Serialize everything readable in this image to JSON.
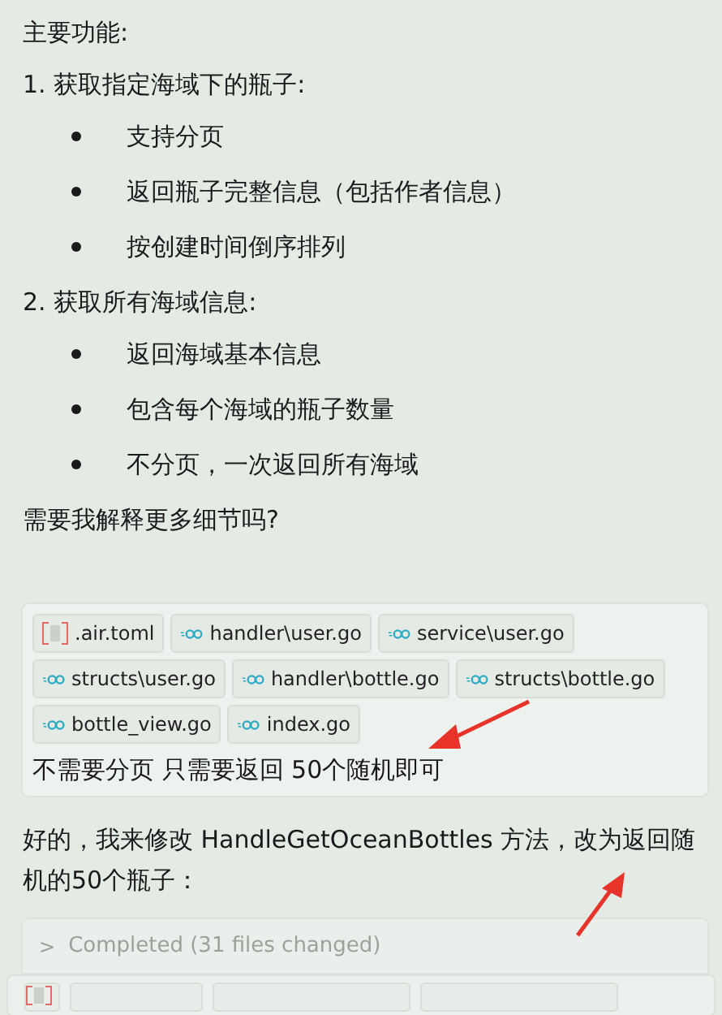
{
  "intro": "主要功能:",
  "sections": [
    {
      "title": "1. 获取指定海域下的瓶子:",
      "bullets": [
        "支持分页",
        "返回瓶子完整信息（包括作者信息）",
        "按创建时间倒序排列"
      ]
    },
    {
      "title": "2. 获取所有海域信息:",
      "bullets": [
        "返回海域基本信息",
        "包含每个海域的瓶子数量",
        "不分页，一次返回所有海域"
      ]
    }
  ],
  "question": "需要我解释更多细节吗?",
  "attachments": [
    {
      "kind": "toml",
      "name": ".air.toml"
    },
    {
      "kind": "go",
      "name": "handler\\user.go"
    },
    {
      "kind": "go",
      "name": "service\\user.go"
    },
    {
      "kind": "go",
      "name": "structs\\user.go"
    },
    {
      "kind": "go",
      "name": "handler\\bottle.go"
    },
    {
      "kind": "go",
      "name": "structs\\bottle.go"
    },
    {
      "kind": "go",
      "name": "bottle_view.go"
    },
    {
      "kind": "go",
      "name": "index.go"
    }
  ],
  "message": "不需要分页 只需要返回 50个随机即可",
  "reply": "好的，我来修改 HandleGetOceanBottles 方法，改为返回随机的50个瓶子：",
  "status": {
    "icon": ">",
    "label": "Completed (31 files changed)"
  }
}
